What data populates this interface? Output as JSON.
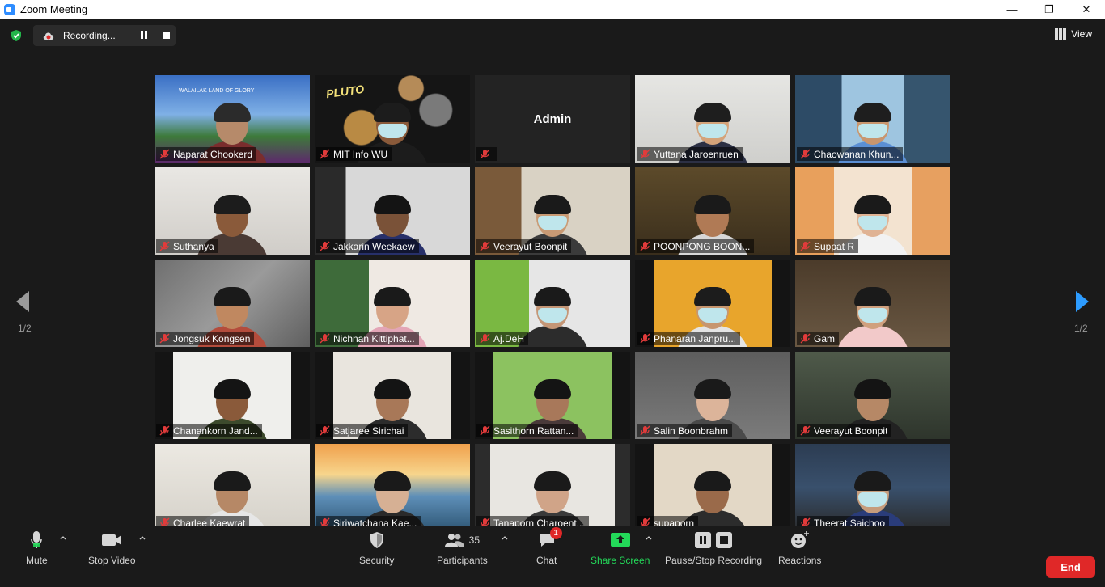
{
  "window": {
    "title": "Zoom Meeting",
    "minimize": "—",
    "maximize": "❐",
    "close": "✕"
  },
  "recording": {
    "label": "Recording..."
  },
  "view": {
    "label": "View"
  },
  "pager": {
    "left": "1/2",
    "right": "1/2"
  },
  "participants": [
    {
      "name": "Naparat Chookerd",
      "scene": "landscape",
      "banner": "WALAILAK LAND OF GLORY"
    },
    {
      "name": "MIT Info WU",
      "scene": "pluto",
      "banner": "PLUTO",
      "active": true
    },
    {
      "name": "",
      "scene": "admin",
      "display": "Admin"
    },
    {
      "name": "Yuttana Jaroenruen",
      "scene": "office"
    },
    {
      "name": "Chaowanan Khun...",
      "scene": "office2"
    },
    {
      "name": "Suthanya",
      "scene": "room"
    },
    {
      "name": "Jakkarin Weekaew",
      "scene": "dark"
    },
    {
      "name": "Veerayut Boonpit",
      "scene": "room2"
    },
    {
      "name": "POONPONG BOON...",
      "scene": "warm"
    },
    {
      "name": "Suppat R",
      "scene": "orange"
    },
    {
      "name": "Jongsuk Kongsen",
      "scene": "stone"
    },
    {
      "name": "Nichnan Kittiphat...",
      "scene": "plant"
    },
    {
      "name": "Aj.DeH",
      "scene": "green"
    },
    {
      "name": "Phanaran Janpru...",
      "scene": "yellow"
    },
    {
      "name": "Gam",
      "scene": "office3"
    },
    {
      "name": "Chanankorn Jand...",
      "scene": "white"
    },
    {
      "name": "Satjaree Sirichai",
      "scene": "curtain"
    },
    {
      "name": "Sasithorn Rattan...",
      "scene": "grass"
    },
    {
      "name": "Salin Boonbrahm",
      "scene": "grey"
    },
    {
      "name": "Veerayut Boonpit",
      "scene": "blur"
    },
    {
      "name": "Charlee Kaewrat",
      "scene": "cream"
    },
    {
      "name": "Siriwatchana Kae...",
      "scene": "bridge"
    },
    {
      "name": "Tanaporn Charoent...",
      "scene": "greenhouse"
    },
    {
      "name": "supaporn",
      "scene": "beige"
    },
    {
      "name": "Theerat Saichoo",
      "scene": "team"
    }
  ],
  "toolbar": {
    "mute": "Mute",
    "stop_video": "Stop Video",
    "security": "Security",
    "participants": "Participants",
    "participant_count": "35",
    "chat": "Chat",
    "chat_badge": "1",
    "share_screen": "Share Screen",
    "recording": "Pause/Stop Recording",
    "reactions": "Reactions",
    "end": "End"
  },
  "colors": {
    "accent_green": "#23d959",
    "end_red": "#e02828",
    "active_speaker": "#e5e17a"
  }
}
